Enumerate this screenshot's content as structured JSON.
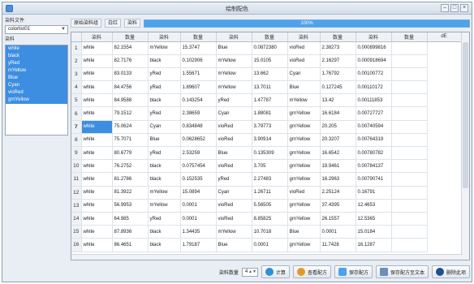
{
  "window": {
    "title": "绘制配色",
    "min": "–",
    "restore": "□",
    "close": "×"
  },
  "left": {
    "label1": "染料文件",
    "combo": "colorlist01",
    "label2": "染料",
    "items": [
      "white",
      "black",
      "yRed",
      "mYellow",
      "Blue",
      "Cyan",
      "vioRed",
      "grnYellow"
    ]
  },
  "toolbar": {
    "item1": "原始染料组",
    "item2": "白红",
    "item3": "染料",
    "progress_text": "100%",
    "progress_value": 1.0
  },
  "table": {
    "headers": [
      "染料",
      "数量",
      "染料",
      "数量",
      "染料",
      "数量",
      "染料",
      "数量",
      "染料",
      "数量",
      "dE"
    ],
    "rows": [
      [
        "1",
        "white",
        "82.1554",
        "mYellow",
        "15.3747",
        "Blue",
        "0.0872380",
        "vioRed",
        "2.38273",
        "0.000899816"
      ],
      [
        "2",
        "white",
        "82.7176",
        "black",
        "0.102906",
        "mYellow",
        "15.0105",
        "vioRed",
        "2.16297",
        "0.000918694"
      ],
      [
        "3",
        "white",
        "83.0133",
        "yRed",
        "1.55671",
        "mYellow",
        "13.662",
        "Cyan",
        "1.76792",
        "0.00100772"
      ],
      [
        "4",
        "white",
        "84.4756",
        "yRed",
        "1.89607",
        "mYellow",
        "13.7011",
        "Blue",
        "0.127245",
        "0.00110172"
      ],
      [
        "5",
        "white",
        "84.9588",
        "black",
        "0.143254",
        "yRed",
        "1.47787",
        "mYellow",
        "13.42",
        "0.00111853"
      ],
      [
        "6",
        "white",
        "79.1512",
        "yRed",
        "2.38659",
        "Cyan",
        "1.88081",
        "grnYellow",
        "16.6184",
        "0.00727727"
      ],
      [
        "7",
        "white",
        "75.0624",
        "Cyan",
        "0.834848",
        "vioRed",
        "3.79773",
        "grnYellow",
        "20.205",
        "0.00740594"
      ],
      [
        "8",
        "white",
        "75.7071",
        "Blue",
        "0.0628652",
        "vioRed",
        "3.90914",
        "grnYellow",
        "20.3207",
        "0.00764319"
      ],
      [
        "9",
        "white",
        "80.6779",
        "yRed",
        "2.53259",
        "Blue",
        "0.135309",
        "grnYellow",
        "16.6542",
        "0.00780782"
      ],
      [
        "10",
        "white",
        "76.2752",
        "black",
        "0.0757454",
        "vioRed",
        "3.705",
        "grnYellow",
        "19.9461",
        "0.00784137"
      ],
      [
        "11",
        "white",
        "81.2786",
        "black",
        "0.152535",
        "yRed",
        "2.27483",
        "grnYellow",
        "16.2963",
        "0.00790741"
      ],
      [
        "12",
        "white",
        "81.3922",
        "mYellow",
        "15.0894",
        "Cyan",
        "1.26711",
        "vioRed",
        "2.25124",
        "0.16791"
      ],
      [
        "13",
        "white",
        "56.9953",
        "mYellow",
        "0.0001",
        "vioRed",
        "5.56505",
        "grnYellow",
        "37.4395",
        "12.4653"
      ],
      [
        "14",
        "white",
        "64.985",
        "yRed",
        "0.0001",
        "vioRed",
        "8.85825",
        "grnYellow",
        "26.1557",
        "12.5365"
      ],
      [
        "15",
        "white",
        "87.8936",
        "black",
        "1.34435",
        "mYellow",
        "10.7018",
        "Blue",
        "0.0001",
        "15.0184"
      ],
      [
        "16",
        "white",
        "86.4651",
        "black",
        "1.79187",
        "Blue",
        "0.0001",
        "grnYellow",
        "11.7428",
        "16.1287"
      ]
    ],
    "selected_row": 7
  },
  "bottom": {
    "count_label": "染料数量",
    "count_value": "4",
    "buttons": [
      "计算",
      "查看配方",
      "保存配方",
      "保存配方至文本",
      "删除此项"
    ]
  },
  "colors": {
    "accent": "#3d8ee0",
    "header_bg": "#eef2f6"
  }
}
